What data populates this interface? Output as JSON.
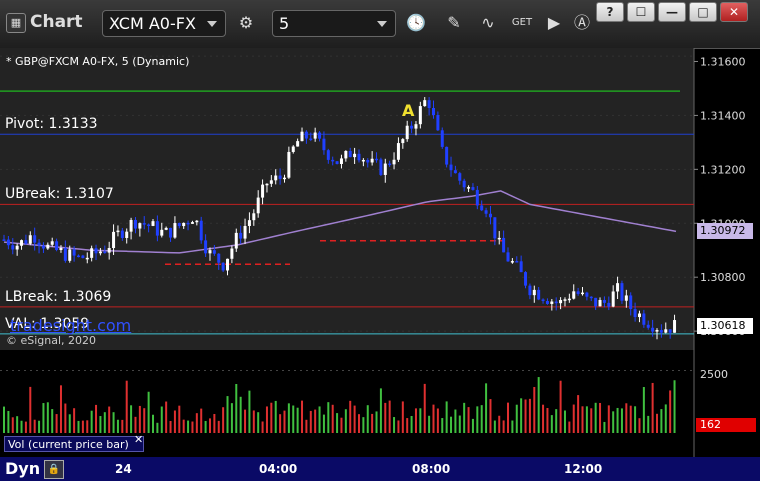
{
  "titlebar": {
    "app_icon": "chart-app-icon",
    "title": "Chart",
    "symbol": "XCM A0-FX",
    "interval": "5",
    "window_buttons": [
      "?",
      "☐",
      "—",
      "□",
      "✕"
    ]
  },
  "chart": {
    "header": "* GBP@FXCM A0-FX, 5 (Dynamic)",
    "watermark_site": "tradesight.com",
    "watermark_copy": "© eSignal, 2020",
    "levels": [
      {
        "label": "Pivot: 1.3133",
        "value": 1.3133,
        "color": "#2040d0"
      },
      {
        "label": "UBreak: 1.3107",
        "value": 1.3107,
        "color": "#c02020"
      },
      {
        "label": "LBreak: 1.3069",
        "value": 1.3069,
        "color": "#c02020"
      },
      {
        "label": "VAL: 1.3059",
        "value": 1.3059,
        "color": "#40c0d0"
      }
    ],
    "top_line_value": 1.3149,
    "annotation_letter": "A",
    "y_ticks": [
      "1.31600",
      "1.31400",
      "1.31200",
      "1.31000",
      "1.30800",
      "1.30600"
    ],
    "price_boxes": [
      {
        "text": "1.30972",
        "value": 1.30972,
        "bg": "#c8b8e8"
      },
      {
        "text": "1.30618",
        "value": 1.30618,
        "bg": "#ffffff"
      }
    ],
    "volume_tick": "2500",
    "volume_current": "162",
    "volume_label": "Vol (current price bar)",
    "x_ticks": [
      "24",
      "04:00",
      "08:00",
      "12:00"
    ],
    "bottom_label": "Dyn"
  },
  "chart_data": {
    "type": "candlestick",
    "instrument": "GBP@FXCM A0-FX",
    "interval": "5",
    "ylim": [
      1.3053,
      1.3165
    ],
    "close_path": [
      [
        0,
        1.3094
      ],
      [
        10,
        1.3092
      ],
      [
        20,
        1.3096
      ],
      [
        30,
        1.3091
      ],
      [
        40,
        1.3089
      ],
      [
        50,
        1.3087
      ],
      [
        60,
        1.3088
      ],
      [
        70,
        1.3091
      ],
      [
        80,
        1.3097
      ],
      [
        90,
        1.3101
      ],
      [
        100,
        1.3099
      ],
      [
        110,
        1.3096
      ],
      [
        120,
        1.3099
      ],
      [
        130,
        1.3103
      ],
      [
        140,
        1.3089
      ],
      [
        150,
        1.3085
      ],
      [
        160,
        1.3095
      ],
      [
        170,
        1.3103
      ],
      [
        180,
        1.3115
      ],
      [
        190,
        1.3117
      ],
      [
        200,
        1.313
      ],
      [
        210,
        1.3133
      ],
      [
        220,
        1.3127
      ],
      [
        230,
        1.3122
      ],
      [
        240,
        1.3128
      ],
      [
        250,
        1.3122
      ],
      [
        260,
        1.312
      ],
      [
        270,
        1.3128
      ],
      [
        280,
        1.3137
      ],
      [
        290,
        1.3147
      ],
      [
        300,
        1.3126
      ],
      [
        310,
        1.3117
      ],
      [
        320,
        1.3112
      ],
      [
        330,
        1.3106
      ],
      [
        340,
        1.309
      ],
      [
        350,
        1.3084
      ],
      [
        360,
        1.3076
      ],
      [
        370,
        1.3073
      ],
      [
        380,
        1.307
      ],
      [
        390,
        1.3075
      ],
      [
        400,
        1.3071
      ],
      [
        410,
        1.307
      ],
      [
        420,
        1.3075
      ],
      [
        430,
        1.3068
      ],
      [
        440,
        1.3064
      ],
      [
        450,
        1.3061
      ],
      [
        460,
        1.3062
      ]
    ],
    "ma_path": [
      [
        0,
        1.3093
      ],
      [
        60,
        1.309
      ],
      [
        120,
        1.3089
      ],
      [
        160,
        1.3092
      ],
      [
        200,
        1.3097
      ],
      [
        250,
        1.3103
      ],
      [
        290,
        1.3108
      ],
      [
        320,
        1.311
      ],
      [
        340,
        1.3112
      ],
      [
        360,
        1.3107
      ],
      [
        400,
        1.3103
      ],
      [
        460,
        1.3097
      ]
    ],
    "volume_ylim": [
      0,
      3200
    ],
    "volume_tick_value": 2500,
    "volume_current_value": 162
  }
}
